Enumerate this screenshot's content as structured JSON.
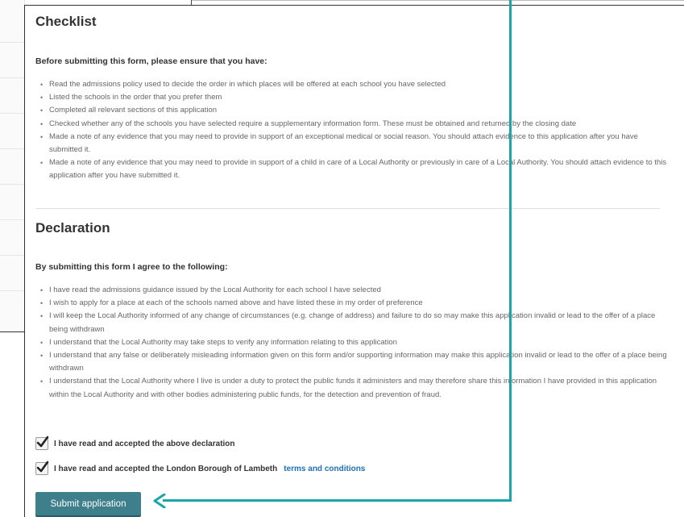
{
  "checklist": {
    "title": "Checklist",
    "lead": "Before submitting this form, please ensure that you have:",
    "items": [
      "Read the admissions policy used to decide the order in which places will be offered at each school you have selected",
      "Listed the schools in the order that you prefer them",
      "Completed all relevant sections of this application",
      "Checked whether any of the schools you have selected require a supplementary information form. These must be obtained and returned by the closing date",
      "Made a note of any evidence that you may need to provide in support of an exceptional medical or social reason. You should attach evidence to this application after you have submitted it.",
      "Made a note of any evidence that you may need to provide in support of a child in care of a Local Authority or previously in care of a Local Authority. You should attach evidence to this application after you have submitted it."
    ]
  },
  "declaration": {
    "title": "Declaration",
    "lead": "By submitting this form I agree to the following:",
    "items": [
      "I have read the admissions guidance issued by the Local Authority for each school I have selected",
      "I wish to apply for a place at each of the schools named above and have listed these in my order of preference",
      "I will keep the Local Authority informed of any change of circumstances (e.g. change of address) and failure to do so may make this application invalid or lead to the offer of a place being withdrawn",
      "I understand that the Local Authority may take steps to verify any information relating to this application",
      "I understand that any false or deliberately misleading information given on this form and/or supporting information may make this application invalid or lead to the offer of a place being withdrawn",
      "I understand that the Local Authority where I live is under a duty to protect the public funds it administers and may therefore share this information I have provided in this application within the Local Authority and with other bodies administering public funds, for the detection and prevention of fraud."
    ]
  },
  "checkboxes": [
    {
      "label": "I have read and accepted the above declaration",
      "checked": true
    },
    {
      "label": "I have read and accepted the London Borough of Lambeth",
      "link": "terms and conditions",
      "checked": true
    }
  ],
  "submit_label": "Submit application",
  "colors": {
    "button": "#3e7f8c",
    "arrow": "#1aa6a8",
    "link": "#1d70b8"
  }
}
